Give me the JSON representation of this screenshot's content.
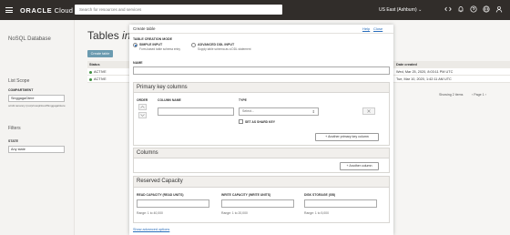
{
  "header": {
    "logo_brand": "ORACLE",
    "logo_suffix": " Cloud",
    "search_placeholder": "Search for resources and services",
    "region": "US East (Ashburn)",
    "region_caret": "⌄"
  },
  "background": {
    "nav_title": "NoSQL Database",
    "list_scope": "List Scope",
    "compartment_label": "COMPARTMENT",
    "compartment_value": "SinggagaGtere",
    "compartment_path": "ocid1.tenancy (root)/nosqlcloud/SinggagaGtere",
    "filters_label": "Filters",
    "state_label": "STATE",
    "state_value": "Any state",
    "page_title_prefix": "Tables ",
    "page_title_italic": "in S",
    "create_button": "Create table",
    "status_header": "Status",
    "rows_status": [
      "ACTIVE",
      "ACTIVE"
    ],
    "date_header": "Date created",
    "rows_date": [
      "Wed, Mar 25, 2020, 8:03:11 PM UTC",
      "Tue, Mar 10, 2020, 1:42:11 AM UTC"
    ],
    "showing": "Showing 2 items",
    "pager": "‹ Page 1 ›"
  },
  "dialog": {
    "title": "Create table",
    "help": "Help",
    "close": "Close",
    "mode_label": "TABLE CREATION MODE",
    "simple_label": "SIMPLE INPUT",
    "simple_sub": "Form-based table schema entry",
    "advanced_label": "ADVANCED DDL INPUT",
    "advanced_sub": "Supply table schema as a DDL statement",
    "name_label": "NAME",
    "pk_section": "Primary key columns",
    "order_label": "ORDER",
    "column_name_label": "COLUMN NAME",
    "type_label": "TYPE",
    "type_placeholder": "Select...",
    "shard_label": "SET AS SHARD KEY",
    "add_pk_button": "+ Another primary key column",
    "columns_section": "Columns",
    "add_column_button": "+ Another column",
    "capacity_section": "Reserved Capacity",
    "read_label": "READ CAPACITY (READ UNITS)",
    "write_label": "WRITE CAPACITY (WRITE UNITS)",
    "storage_label": "DISK STORAGE (GB)",
    "read_range": "Range: 1 to 40,000",
    "write_range": "Range: 1 to 20,000",
    "storage_range": "Range: 1 to 5,000",
    "advanced_link": "Show advanced options"
  }
}
